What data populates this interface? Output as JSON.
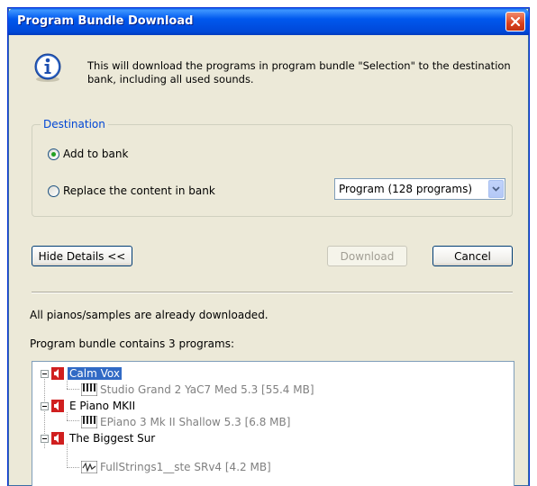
{
  "window": {
    "title": "Program Bundle Download"
  },
  "info": {
    "message": "This will download the programs in program bundle \"Selection\" to the destination bank, including all used sounds."
  },
  "destination": {
    "group_label": "Destination",
    "option_add": "Add to bank",
    "option_add_selected": true,
    "option_replace": "Replace the content in bank",
    "option_replace_selected": false,
    "bank_select_value": "Program (128 programs)"
  },
  "buttons": {
    "hide_details": "Hide Details <<",
    "download": "Download",
    "cancel": "Cancel"
  },
  "status": {
    "downloaded_text": "All pianos/samples are already downloaded.",
    "bundle_count_text": "Program bundle contains 3 programs:"
  },
  "tree": {
    "programs": [
      {
        "name": "Calm Vox",
        "selected": true,
        "sound": "Studio Grand 2 YaC7  Med 5.3 [55.4 MB]",
        "sound_icon": "piano-keys-icon"
      },
      {
        "name": "E Piano MKII",
        "selected": false,
        "sound": "EPiano 3  Mk II Shallow 5.3 [6.8 MB]",
        "sound_icon": "piano-keys-icon"
      },
      {
        "name": "The Biggest Sur",
        "selected": false,
        "sound": "FullStrings1__ste SRv4 [4.2 MB]",
        "sound_icon": "waveform-icon"
      }
    ]
  },
  "colors": {
    "titlebar": "#0058ee",
    "group_label": "#0046d5",
    "selection": "#316ac5",
    "radio_dot": "#21a121",
    "close_button": "#d9401d"
  }
}
